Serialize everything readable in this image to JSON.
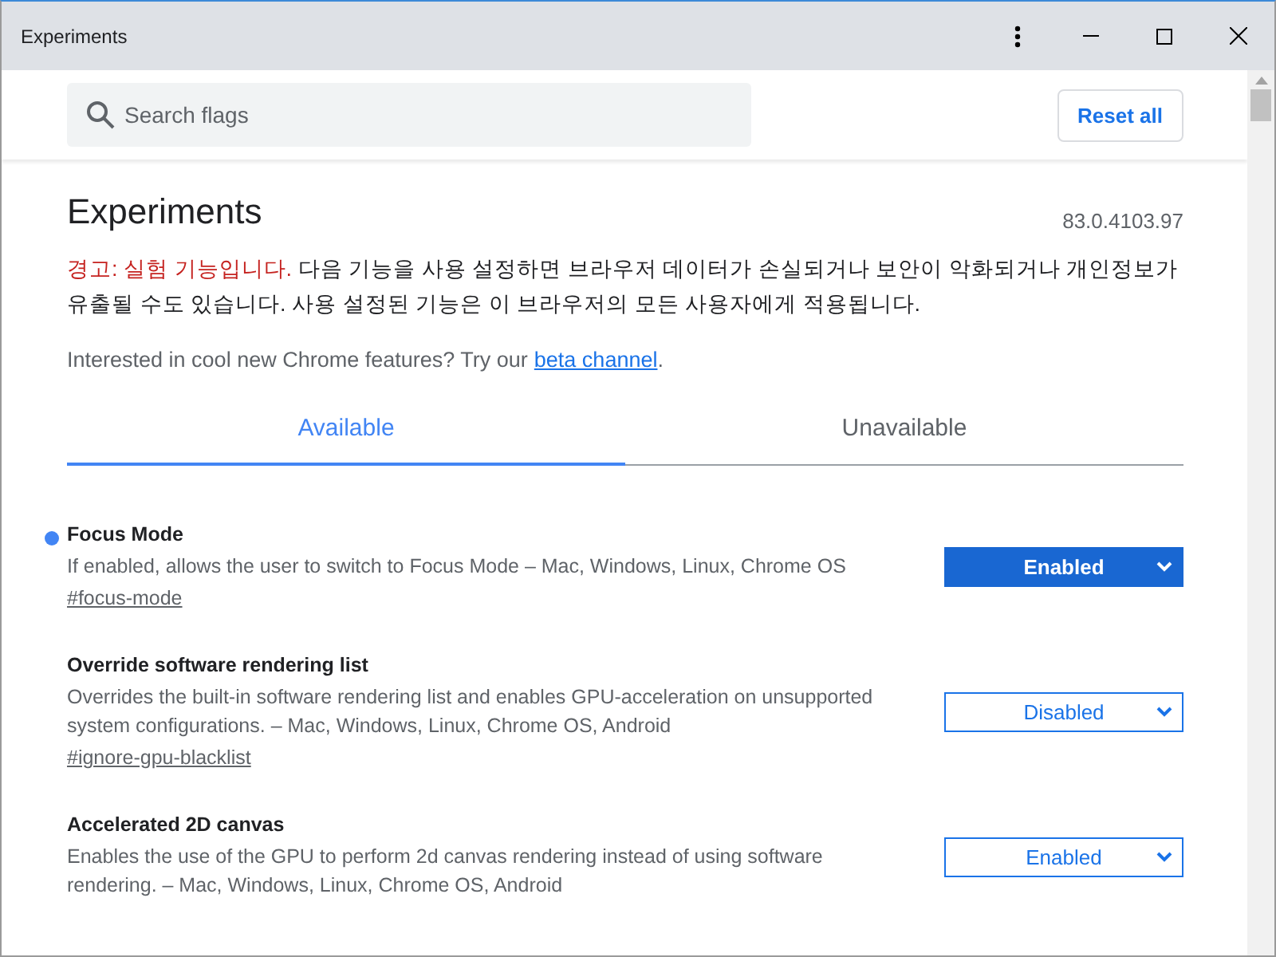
{
  "window": {
    "title": "Experiments"
  },
  "search": {
    "placeholder": "Search flags"
  },
  "reset_button": "Reset all",
  "page": {
    "title": "Experiments",
    "version": "83.0.4103.97",
    "warning_label": "경고: 실험 기능입니다.",
    "warning_text": "다음 기능을 사용 설정하면 브라우저 데이터가 손실되거나 보안이 악화되거나 개인정보가 유출될 수도 있습니다. 사용 설정된 기능은 이 브라우저의 모든 사용자에게 적용됩니다.",
    "intro_text": "Interested in cool new Chrome features? Try our",
    "intro_link": "beta channel",
    "intro_end": "."
  },
  "tabs": [
    {
      "label": "Available",
      "selected": true
    },
    {
      "label": "Unavailable",
      "selected": false
    }
  ],
  "flags": [
    {
      "name": "Focus Mode",
      "modified": true,
      "description": "If enabled, allows the user to switch to Focus Mode – Mac, Windows, Linux, Chrome OS",
      "link": "#focus-mode",
      "value": "Enabled"
    },
    {
      "name": "Override software rendering list",
      "modified": false,
      "description": "Overrides the built-in software rendering list and enables GPU-acceleration on unsupported system configurations. – Mac, Windows, Linux, Chrome OS, Android",
      "link": "#ignore-gpu-blacklist",
      "value": "Disabled"
    },
    {
      "name": "Accelerated 2D canvas",
      "modified": false,
      "description": "Enables the use of the GPU to perform 2d canvas rendering instead of using software rendering. – Mac, Windows, Linux, Chrome OS, Android",
      "value": "Enabled"
    }
  ]
}
